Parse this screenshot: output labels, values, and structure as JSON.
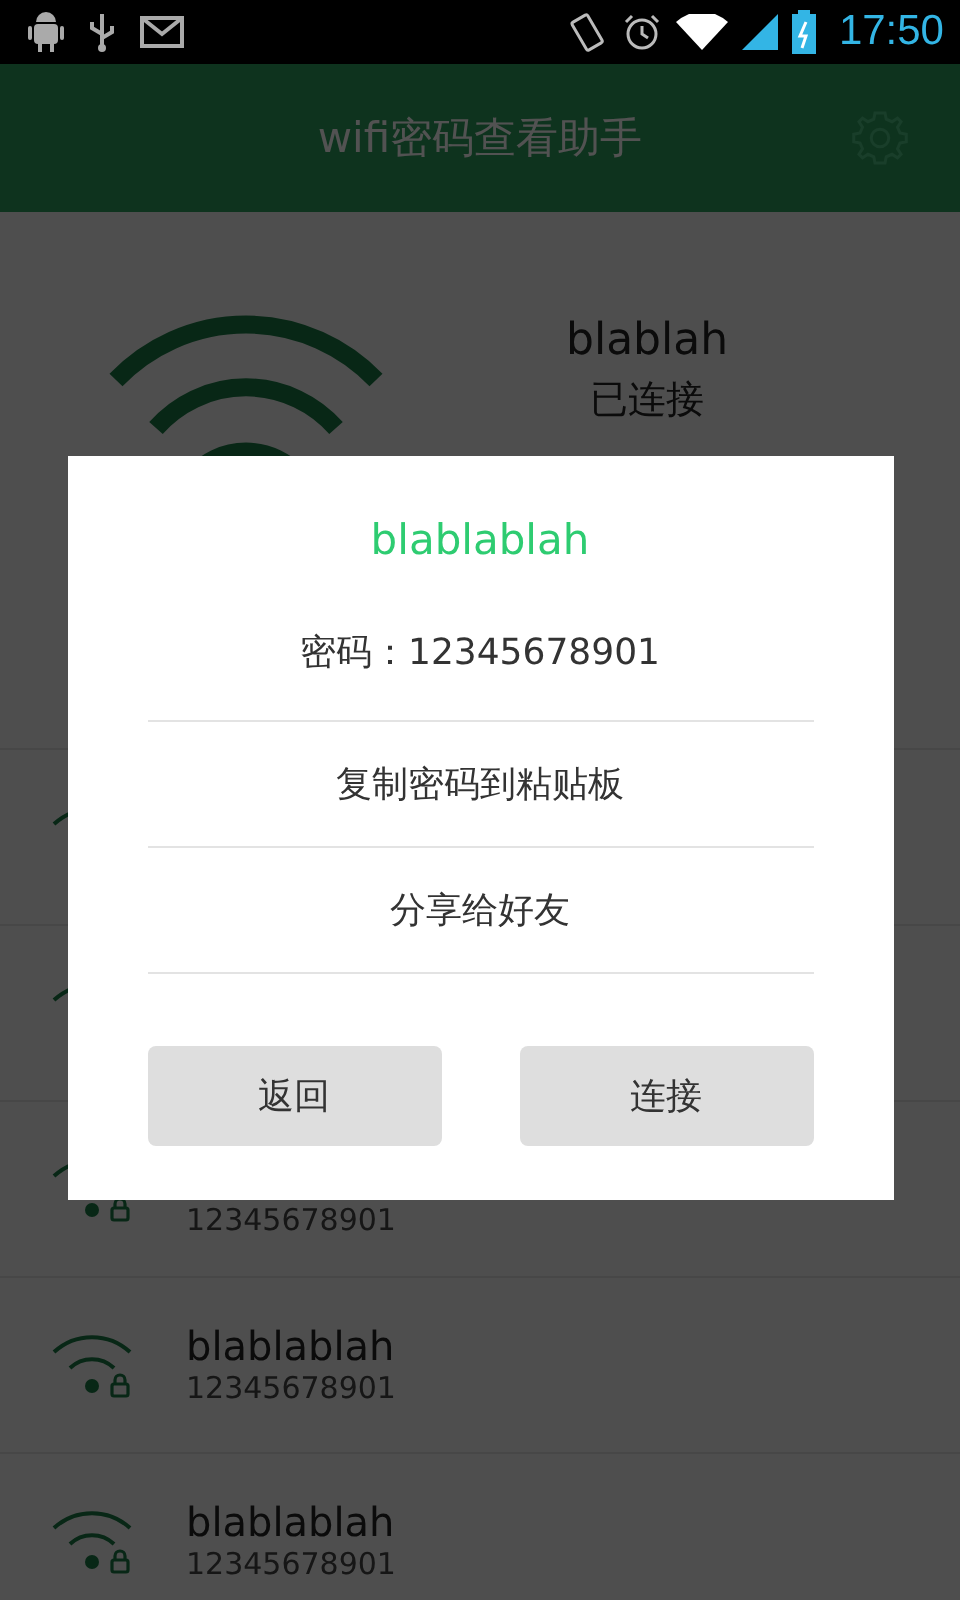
{
  "status_bar": {
    "time": "17:50"
  },
  "toolbar": {
    "title": "wifi密码查看助手"
  },
  "current_network": {
    "name": "blablah",
    "status": "已连接"
  },
  "networks": [
    {
      "kind": "network"
    },
    {
      "kind": "network"
    },
    {
      "kind": "network",
      "secured": true,
      "password": "12345678901"
    },
    {
      "kind": "network",
      "secured": true,
      "name": "blablablah",
      "password": "12345678901"
    },
    {
      "kind": "network",
      "secured": true,
      "name": "blablablah",
      "password": "12345678901"
    }
  ],
  "dialog": {
    "title": "blablablah",
    "password_line": "密码：12345678901",
    "actions": [
      "复制密码到粘贴板",
      "分享给好友"
    ],
    "buttons": [
      "返回",
      "连接"
    ]
  }
}
